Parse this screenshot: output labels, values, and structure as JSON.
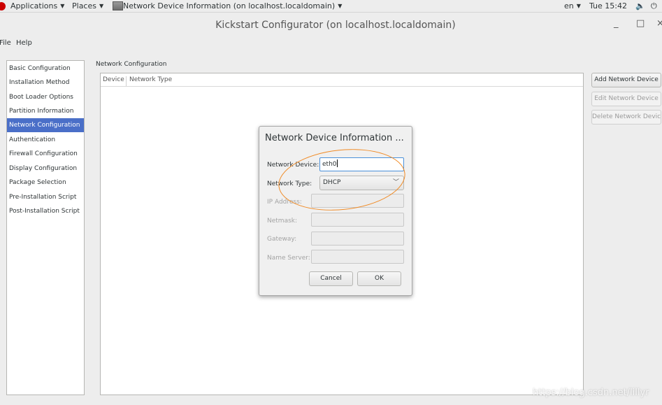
{
  "topbar": {
    "applications": "Applications",
    "places": "Places",
    "active_window": "Network Device Information (on localhost.localdomain)",
    "language": "en",
    "clock": "Tue 15:42"
  },
  "window": {
    "title": "Kickstart Configurator (on localhost.localdomain)",
    "minimize": "_",
    "maximize": "□",
    "close": "×"
  },
  "menubar": {
    "file": "File",
    "help": "Help"
  },
  "sidebar": {
    "items": [
      {
        "label": "Basic Configuration"
      },
      {
        "label": "Installation Method"
      },
      {
        "label": "Boot Loader Options"
      },
      {
        "label": "Partition Information"
      },
      {
        "label": "Network Configuration"
      },
      {
        "label": "Authentication"
      },
      {
        "label": "Firewall Configuration"
      },
      {
        "label": "Display Configuration"
      },
      {
        "label": "Package Selection"
      },
      {
        "label": "Pre-Installation Script"
      },
      {
        "label": "Post-Installation Script"
      }
    ],
    "selected_index": 4
  },
  "main": {
    "section_title": "Network Configuration",
    "table": {
      "columns": [
        "Device",
        "Network Type"
      ],
      "rows": []
    }
  },
  "actions": {
    "add": "Add Network Device",
    "edit": "Edit Network Device",
    "delete": "Delete Network Device"
  },
  "dialog": {
    "title": "Network Device Information ...",
    "network_device_label": "Network Device:",
    "network_device_value": "eth0",
    "network_type_label": "Network Type:",
    "network_type_value": "DHCP",
    "ip_address_label": "IP Address:",
    "netmask_label": "Netmask:",
    "gateway_label": "Gateway:",
    "name_server_label": "Name Server:",
    "cancel": "Cancel",
    "ok": "OK"
  },
  "watermark": "https://blog.csdn.net/lillyr",
  "colors": {
    "selection": "#4a6fc8",
    "annotation": "#f08a24"
  }
}
